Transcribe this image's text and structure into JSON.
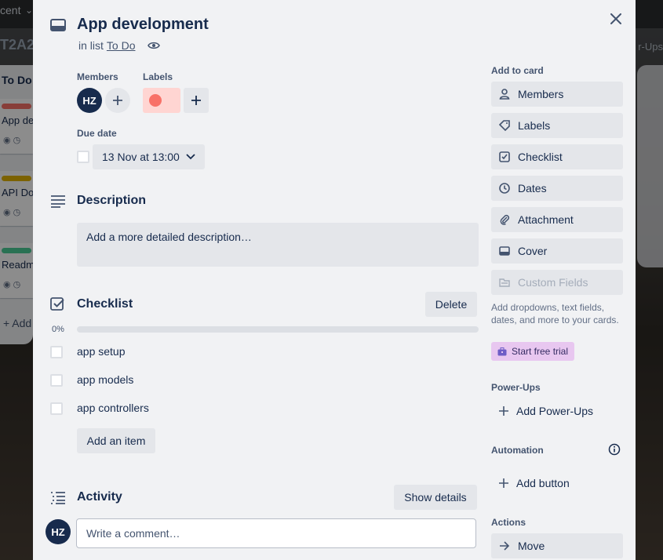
{
  "background": {
    "top_menu": "cent",
    "board_title": "T2A2",
    "right_hint": "r-Ups",
    "list_title": "To Do",
    "cards": [
      {
        "title": "App de",
        "color": "#f87168"
      },
      {
        "title": "API Do",
        "color": "#e2b203"
      },
      {
        "title": "Readm",
        "color": "#4bce97"
      }
    ],
    "add_card": "+ Add"
  },
  "card": {
    "title": "App development",
    "in_list_prefix": "in list",
    "list_name": "To Do"
  },
  "members": {
    "label": "Members",
    "avatar_initials": "HZ"
  },
  "labels": {
    "label": "Labels",
    "label_color": "#f87168"
  },
  "due_date": {
    "label": "Due date",
    "value": "13 Nov at 13:00"
  },
  "description": {
    "title": "Description",
    "placeholder": "Add a more detailed description…"
  },
  "checklist": {
    "title": "Checklist",
    "delete_label": "Delete",
    "progress_text": "0%",
    "progress_fraction": 0,
    "items": [
      "app setup",
      "app models",
      "app controllers"
    ],
    "add_item_label": "Add an item"
  },
  "activity": {
    "title": "Activity",
    "show_details_label": "Show details",
    "avatar_initials": "HZ",
    "comment_placeholder": "Write a comment…"
  },
  "sidebar": {
    "add_to_card_heading": "Add to card",
    "buttons": [
      {
        "label": "Members",
        "icon": "person-icon"
      },
      {
        "label": "Labels",
        "icon": "tag-icon"
      },
      {
        "label": "Checklist",
        "icon": "checklist-icon"
      },
      {
        "label": "Dates",
        "icon": "clock-icon"
      },
      {
        "label": "Attachment",
        "icon": "paperclip-icon"
      },
      {
        "label": "Cover",
        "icon": "cover-icon"
      },
      {
        "label": "Custom Fields",
        "icon": "custom-fields-icon"
      }
    ],
    "custom_fields_note": "Add dropdowns, text fields, dates, and more to your cards.",
    "trial_label": "Start free trial",
    "power_ups_heading": "Power-Ups",
    "add_power_ups_label": "Add Power-Ups",
    "automation_heading": "Automation",
    "add_button_label": "Add button",
    "actions_heading": "Actions",
    "move_label": "Move"
  }
}
